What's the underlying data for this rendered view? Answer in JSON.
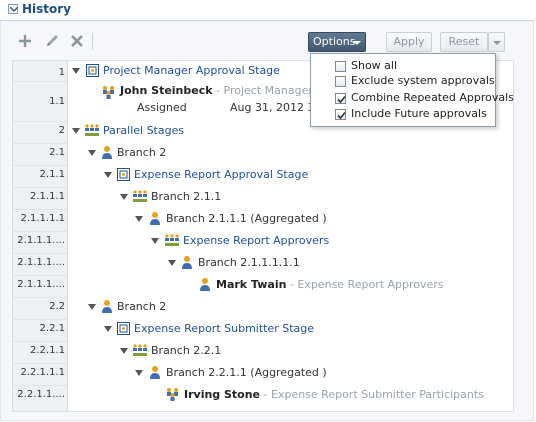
{
  "header": {
    "title": "History"
  },
  "toolbar": {
    "options_label": "Options",
    "apply_label": "Apply",
    "reset_label": "Reset"
  },
  "options_menu": [
    {
      "label": "Show all",
      "checked": false
    },
    {
      "label": "Exclude system approvals",
      "checked": false
    },
    {
      "label": "Combine Repeated Approvals",
      "checked": true
    },
    {
      "label": "Include Future approvals",
      "checked": true
    }
  ],
  "rows": [
    {
      "num": "1",
      "label": "Project Manager Approval Stage",
      "sub": ""
    },
    {
      "num": "1.1",
      "label": "John Steinbeck",
      "sub": "- Project Manager Ap",
      "status": "Assigned",
      "date": "Aug 31, 2012 3:"
    },
    {
      "num": "2",
      "label": "Parallel Stages",
      "sub": ""
    },
    {
      "num": "2.1",
      "label": "Branch 2",
      "sub": ""
    },
    {
      "num": "2.1.1",
      "label": "Expense Report Approval Stage",
      "sub": ""
    },
    {
      "num": "2.1.1.1",
      "label": "Branch 2.1.1",
      "sub": ""
    },
    {
      "num": "2.1.1.1.1",
      "label": "Branch 2.1.1.1 (Aggregated )",
      "sub": ""
    },
    {
      "num": "2.1.1.1....",
      "label": "Expense Report Approvers",
      "sub": ""
    },
    {
      "num": "2.1.1.1....",
      "label": "Branch 2.1.1.1.1.1",
      "sub": ""
    },
    {
      "num": "2.1.1.1....",
      "label": "Mark Twain",
      "sub": "- Expense Report Approvers"
    },
    {
      "num": "2.2",
      "label": "Branch 2",
      "sub": ""
    },
    {
      "num": "2.2.1",
      "label": "Expense Report Submitter Stage",
      "sub": ""
    },
    {
      "num": "2.2.1.1",
      "label": "Branch 2.2.1",
      "sub": ""
    },
    {
      "num": "2.2.1.1.1",
      "label": "Branch 2.2.1.1 (Aggregated )",
      "sub": ""
    },
    {
      "num": "2.2.1.1....",
      "label": "Irving Stone",
      "sub": "- Expense Report Submitter Participants"
    }
  ]
}
